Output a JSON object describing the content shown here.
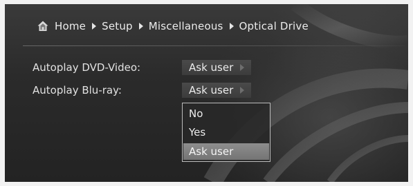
{
  "breadcrumb": {
    "items": [
      "Home",
      "Setup",
      "Miscellaneous",
      "Optical Drive"
    ]
  },
  "settings": [
    {
      "label": "Autoplay DVD-Video:",
      "value": "Ask user"
    },
    {
      "label": "Autoplay Blu-ray:",
      "value": "Ask user"
    }
  ],
  "dropdown": {
    "options": [
      "No",
      "Yes",
      "Ask user"
    ],
    "selected": "Ask user"
  },
  "icons": {
    "home": "home-icon",
    "separator": "chevron-right-icon",
    "value_arrow": "chevron-right-icon"
  },
  "colors": {
    "text": "#ececec",
    "background": "#2b2b2b",
    "highlight": "#8a8a8a",
    "dropdown_border": "#bdbdbd"
  }
}
